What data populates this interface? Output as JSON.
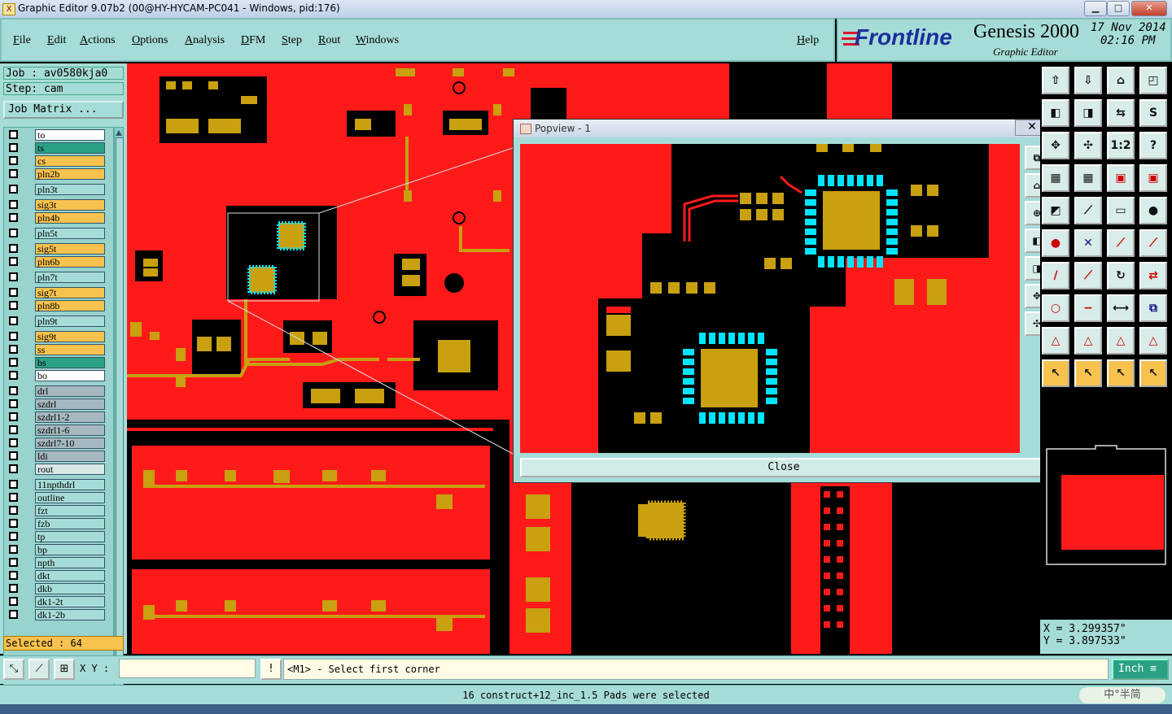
{
  "window": {
    "title": "Graphic Editor 9.07b2 (00@HY-HYCAM-PC041 - Windows, pid:176)",
    "app_icon": "X",
    "minimize_icon": "minimize-icon",
    "maximize_icon": "maximize-icon",
    "close_icon": "close-icon"
  },
  "menu": [
    "File",
    "Edit",
    "Actions",
    "Options",
    "Analysis",
    "DFM",
    "Step",
    "Rout",
    "Windows"
  ],
  "help": "Help",
  "brand": {
    "logo": "Frontline",
    "product": "Genesis 2000",
    "subtitle": "Graphic Editor",
    "date": "17 Nov 2014",
    "time": "02:16 PM"
  },
  "job": {
    "job_line": "Job : av0580kja0",
    "step_line": "Step: cam",
    "matrix_button": "Job Matrix ..."
  },
  "layers": [
    {
      "name": "to",
      "color": "#ffffff"
    },
    {
      "name": "ts",
      "color": "#2aa184"
    },
    {
      "name": "cs",
      "color": "#f8c24f"
    },
    {
      "name": "pln2b",
      "color": "#f8c24f"
    },
    {
      "name": "pln3t",
      "color": "#a6dcd7"
    },
    {
      "name": "sig3t",
      "color": "#f8c24f"
    },
    {
      "name": "pln4b",
      "color": "#f8c24f"
    },
    {
      "name": "pln5t",
      "color": "#a6dcd7"
    },
    {
      "name": "sig5t",
      "color": "#f8c24f"
    },
    {
      "name": "pln6b",
      "color": "#f8c24f"
    },
    {
      "name": "pln7t",
      "color": "#a6dcd7"
    },
    {
      "name": "sig7t",
      "color": "#f8c24f"
    },
    {
      "name": "pln8b",
      "color": "#f8c24f"
    },
    {
      "name": "pln9t",
      "color": "#a6dcd7"
    },
    {
      "name": "sig9t",
      "color": "#f8c24f"
    },
    {
      "name": "ss",
      "color": "#f8c24f"
    },
    {
      "name": "bs",
      "color": "#2aa184"
    },
    {
      "name": "bo",
      "color": "#ffffff"
    },
    {
      "name": "drl",
      "color": "#a6b8bf"
    },
    {
      "name": "szdrl",
      "color": "#a6b8bf"
    },
    {
      "name": "szdrl1-2",
      "color": "#a6b8bf"
    },
    {
      "name": "szdrl1-6",
      "color": "#a6b8bf"
    },
    {
      "name": "szdrl7-10",
      "color": "#a6b8bf"
    },
    {
      "name": "ldi",
      "color": "#a6b8bf"
    },
    {
      "name": "rout",
      "color": "#d8e8e6"
    },
    {
      "name": "11npthdrl",
      "color": "#a6dcd7"
    },
    {
      "name": "outline",
      "color": "#a6dcd7"
    },
    {
      "name": "fzt",
      "color": "#a6dcd7"
    },
    {
      "name": "fzb",
      "color": "#a6dcd7"
    },
    {
      "name": "tp",
      "color": "#a6dcd7"
    },
    {
      "name": "bp",
      "color": "#a6dcd7"
    },
    {
      "name": "npth",
      "color": "#a6dcd7"
    },
    {
      "name": "dkt",
      "color": "#a6dcd7"
    },
    {
      "name": "dkb",
      "color": "#a6dcd7"
    },
    {
      "name": "dk1-2t",
      "color": "#a6dcd7"
    },
    {
      "name": "dk1-2b",
      "color": "#a6dcd7"
    }
  ],
  "selected": "Selected : 64",
  "popview": {
    "title": "Popview - 1",
    "close_label": "Close"
  },
  "coords": {
    "x": "X = 3.299357\"",
    "y": "Y = 3.897533\""
  },
  "bottom": {
    "xy_label": "X Y :",
    "xy_value": "",
    "prompt": "<M1> - Select first corner",
    "units": "Inch",
    "status": "16 construct+12_inc_1.5 Pads were selected"
  },
  "colors": {
    "board": "#ff1a1a",
    "copper": "#c8a010",
    "dark": "#000000",
    "highlight": "#00e5ff",
    "panel": "#a6dcd7"
  },
  "ime": "中°半简"
}
